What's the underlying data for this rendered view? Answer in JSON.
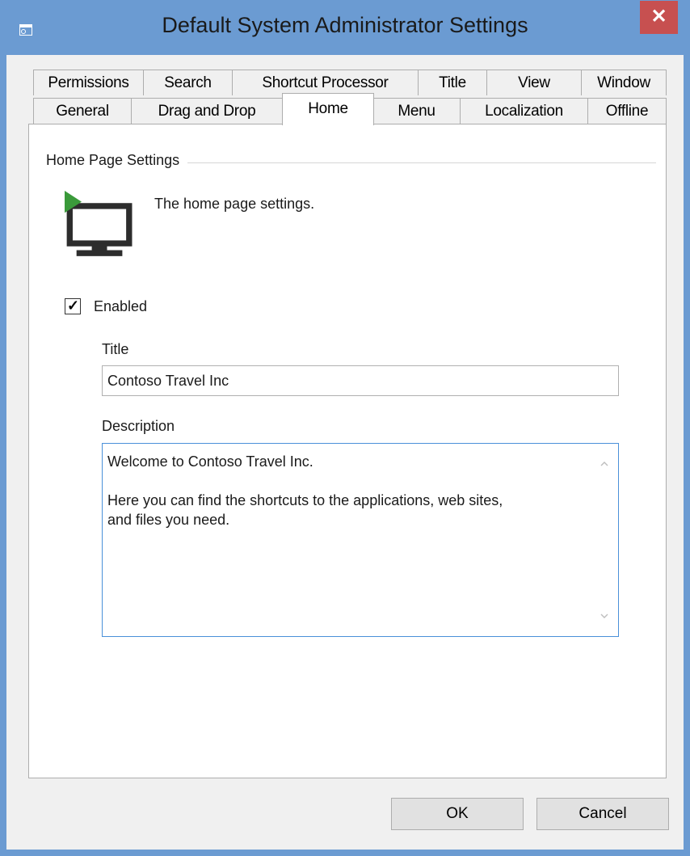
{
  "window": {
    "title": "Default System Administrator Settings",
    "close_label": "✕"
  },
  "tabs": {
    "row1": [
      {
        "label": "Permissions"
      },
      {
        "label": "Search"
      },
      {
        "label": "Shortcut Processor"
      },
      {
        "label": "Title"
      },
      {
        "label": "View"
      },
      {
        "label": "Window"
      }
    ],
    "row2": [
      {
        "label": "General"
      },
      {
        "label": "Drag and Drop"
      },
      {
        "label": "Home",
        "active": true
      },
      {
        "label": "Menu"
      },
      {
        "label": "Localization"
      },
      {
        "label": "Offline"
      }
    ]
  },
  "home": {
    "group_label": "Home Page Settings",
    "description": "The home page settings.",
    "enabled_label": "Enabled",
    "enabled_checked": true,
    "title_label": "Title",
    "title_value": "Contoso Travel Inc",
    "description_label": "Description",
    "description_value": "Welcome to Contoso Travel Inc.\n\nHere you can find the shortcuts to the applications, web sites,\nand files you need."
  },
  "buttons": {
    "ok": "OK",
    "cancel": "Cancel"
  },
  "icons": {
    "app": "settings-window-icon",
    "monitor": "monitor-icon",
    "play": "green-play-icon"
  },
  "colors": {
    "titlebar": "#6b9bd2",
    "close": "#c75050",
    "accent_green": "#3a9a3a",
    "focus_border": "#4a90d9"
  }
}
